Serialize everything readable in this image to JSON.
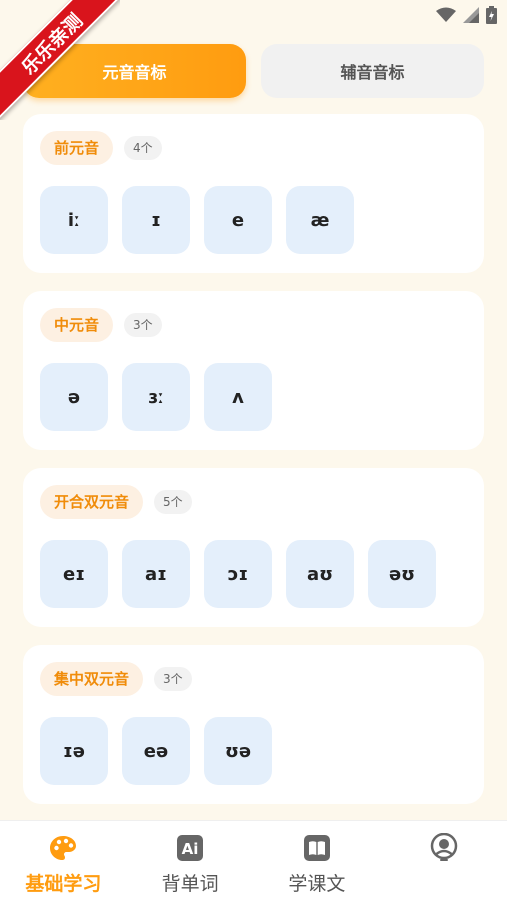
{
  "ribbon": {
    "text": "乐乐亲测"
  },
  "tabs": [
    {
      "label": "元音音标",
      "active": true
    },
    {
      "label": "辅音音标",
      "active": false
    }
  ],
  "groups": [
    {
      "name": "前元音",
      "count": "4个",
      "symbols": [
        "iː",
        "ɪ",
        "e",
        "æ"
      ]
    },
    {
      "name": "中元音",
      "count": "3个",
      "symbols": [
        "ə",
        "ɜː",
        "ʌ"
      ]
    },
    {
      "name": "开合双元音",
      "count": "5个",
      "symbols": [
        "eɪ",
        "aɪ",
        "ɔɪ",
        "aʊ",
        "əʊ"
      ]
    },
    {
      "name": "集中双元音",
      "count": "3个",
      "symbols": [
        "ɪə",
        "eə",
        "ʊə"
      ]
    }
  ],
  "nav": [
    {
      "label": "基础学习",
      "icon": "palette-icon",
      "active": true
    },
    {
      "label": "背单词",
      "icon": "ai-icon",
      "active": false
    },
    {
      "label": "学课文",
      "icon": "book-icon",
      "active": false
    },
    {
      "label": "",
      "icon": "profile-icon",
      "active": false
    }
  ],
  "colors": {
    "accent": "#ff9c10",
    "symbol_bg": "#e4effb",
    "pill_bg": "#fdf0e2"
  }
}
